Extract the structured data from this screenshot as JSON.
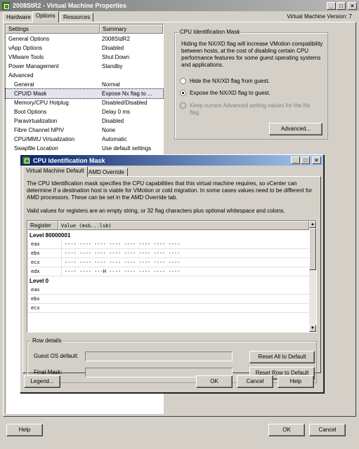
{
  "main_window": {
    "title": "2008StR2 - Virtual Machine Properties",
    "tabs": [
      "Hardware",
      "Options",
      "Resources"
    ],
    "vm_version": "Virtual Machine Version: 7",
    "list_headers": {
      "settings": "Settings",
      "summary": "Summary"
    },
    "options": [
      {
        "setting": "General Options",
        "summary": "2008StdR2"
      },
      {
        "setting": "vApp Options",
        "summary": "Disabled"
      },
      {
        "setting": "VMware Tools",
        "summary": "Shut Down"
      },
      {
        "setting": "Power Management",
        "summary": "Standby"
      },
      {
        "setting": "Advanced",
        "summary": ""
      },
      {
        "setting": "General",
        "summary": "Normal"
      },
      {
        "setting": "CPUID Mask",
        "summary": "Expose Nx flag to ..."
      },
      {
        "setting": "Memory/CPU Hotplug",
        "summary": "Disabled/Disabled"
      },
      {
        "setting": "Boot Options",
        "summary": "Delay 0 ms"
      },
      {
        "setting": "Paravirtualization",
        "summary": "Disabled"
      },
      {
        "setting": "Fibre Channel NPIV",
        "summary": "None"
      },
      {
        "setting": "CPU/MMU Virtualization",
        "summary": "Automatic"
      },
      {
        "setting": "Swapfile Location",
        "summary": "Use default settings"
      }
    ],
    "cpu_mask_group": {
      "title": "CPU Identification Mask",
      "description_1": "Hiding the NX/XD flag will increase VMotion compatibility",
      "description_2": "between hosts, at the cost of disabling certain CPU",
      "description_3": "performance features for some guest operating systems",
      "description_4": "and applications.",
      "radio_hide": "Hide the NX/XD flag from guest.",
      "radio_expose": "Expose the NX/XD flag to guest.",
      "radio_keep_1": "Keep current Advanced setting values for the Nx",
      "radio_keep_2": "flag.",
      "advanced_button": "Advanced..."
    },
    "help_button": "Help",
    "ok_button": "OK",
    "cancel_button": "Cancel"
  },
  "dialog": {
    "title": "CPU Identification Mask",
    "tabs": [
      "Virtual Machine Default",
      "AMD Override"
    ],
    "description_1": "The CPU Identification mask specifies the CPU capabilities that this virtual machine requires, so vCenter can",
    "description_2": "determine if a destination host is viable for VMotion or cold migration. In some cases values need to be different for",
    "description_3": "AMD processors. These can be set in the AMD Override tab.",
    "valid_values": "Valid values for registers are an empty string, or 32 flag characters plus optional whitespace and colons.",
    "table_headers": {
      "register": "Register",
      "value": "Value (msb...lsb)"
    },
    "level_1": "Level 80000001",
    "level_1_rows": [
      {
        "reg": "eax",
        "value": "---- ---- ---- ---- ---- ---- ---- ----"
      },
      {
        "reg": "ebx",
        "value": "---- ---- ---- ---- ---- ---- ---- ----"
      },
      {
        "reg": "ecx",
        "value": "---- ---- ---- ---- ---- ---- ---- ----"
      },
      {
        "reg": "edx",
        "value": "---- ---- ---H ---- ---- ---- ---- ----"
      }
    ],
    "level_0": "Level 0",
    "level_0_rows": [
      {
        "reg": "eax",
        "value": ""
      },
      {
        "reg": "ebx",
        "value": ""
      },
      {
        "reg": "ecx",
        "value": ""
      }
    ],
    "row_details": {
      "title": "Row details",
      "guest_os_default_label": "Guest OS default:",
      "guest_os_default_value": "",
      "final_mask_label": "Final Mask:",
      "final_mask_value": "",
      "reset_all_button": "Reset All to Default",
      "reset_row_button": "Reset Row to Default"
    },
    "legend_button": "Legend...",
    "ok_button": "OK",
    "cancel_button": "Cancel",
    "help_button": "Help"
  },
  "colors": {
    "titlebar_active": "#0a246a",
    "titlebar_inactive": "#808080",
    "selection": "#d4d0c8",
    "panel": "#d4d0c8"
  }
}
